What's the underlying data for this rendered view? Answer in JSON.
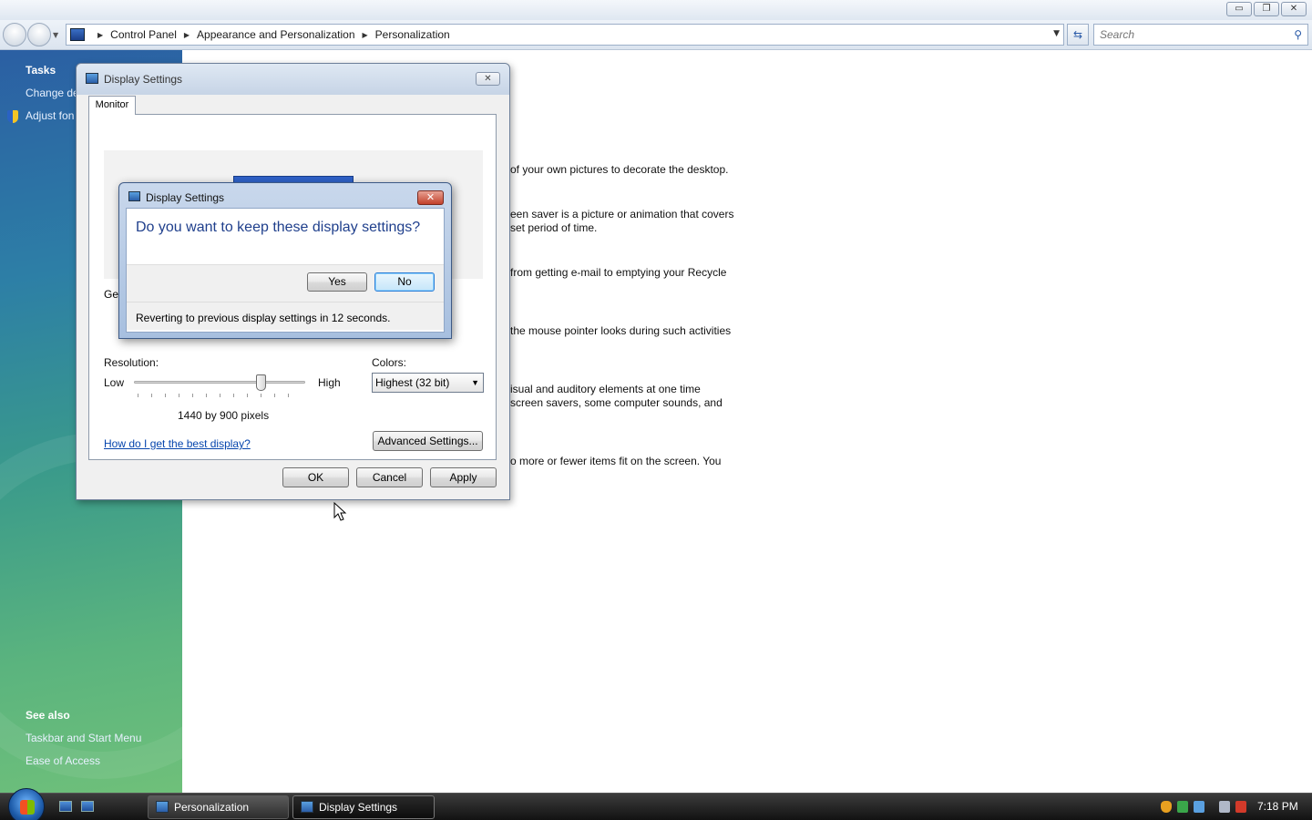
{
  "window": {
    "minimize_label": "▭",
    "restore_label": "❐",
    "close_label": "✕"
  },
  "address": {
    "breadcrumbs": [
      "Control Panel",
      "Appearance and Personalization",
      "Personalization"
    ],
    "search_placeholder": "Search"
  },
  "left_pane": {
    "tasks_heading": "Tasks",
    "tasks": [
      "Change de",
      "Adjust fon"
    ],
    "see_also_heading": "See also",
    "see_also": [
      "Taskbar and Start Menu",
      "Ease of Access"
    ]
  },
  "main": {
    "lines": [
      "of your own pictures to decorate the desktop.",
      "een saver is a picture or animation that covers",
      "set period of time.",
      "from getting e-mail to emptying your Recycle",
      "the mouse pointer looks during such activities",
      "isual and auditory elements at one time",
      "screen savers, some computer sounds, and",
      "o more or fewer items fit on the screen. You"
    ]
  },
  "display_settings": {
    "title": "Display Settings",
    "close_label": "✕",
    "tab_monitor": "Monitor",
    "general_partial": "Ger",
    "resolution_label": "Resolution:",
    "low_label": "Low",
    "high_label": "High",
    "resolution_value": "1440 by 900 pixels",
    "colors_label": "Colors:",
    "colors_value": "Highest (32 bit)",
    "advanced_label": "Advanced Settings...",
    "help_link": "How do I get the best display?",
    "ok_label": "OK",
    "cancel_label": "Cancel",
    "apply_label": "Apply"
  },
  "confirm": {
    "title": "Display Settings",
    "close_label": "✕",
    "question": "Do you want to keep these display settings?",
    "yes_label": "Yes",
    "no_label": "No",
    "revert_text": "Reverting to previous display settings in 12 seconds."
  },
  "taskbar": {
    "tasks": [
      "Personalization",
      "Display Settings"
    ],
    "clock": "7:18 PM"
  }
}
